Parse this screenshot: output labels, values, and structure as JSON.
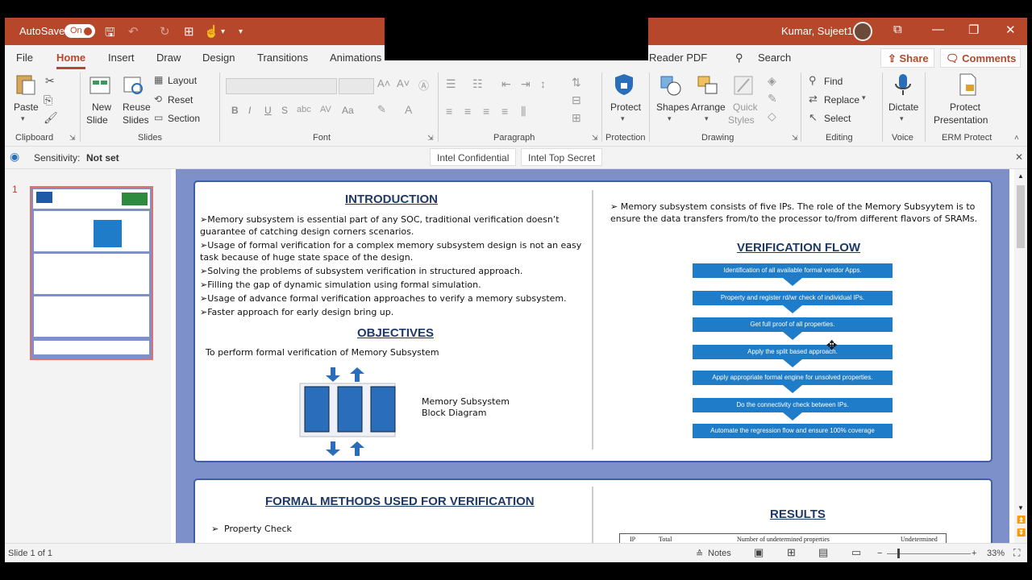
{
  "titlebar": {
    "autosave_label": "AutoSave",
    "autosave_state": "On",
    "user_name": "Kumar, Sujeet1"
  },
  "tabs": [
    "File",
    "Home",
    "Insert",
    "Draw",
    "Design",
    "Transitions",
    "Animations",
    "Reader PDF"
  ],
  "search_label": "Search",
  "share_label": "Share",
  "comments_label": "Comments",
  "ribbon": {
    "clipboard": {
      "paste": "Paste",
      "group": "Clipboard"
    },
    "slides": {
      "new_slide": "New",
      "new_slide2": "Slide",
      "reuse": "Reuse",
      "reuse2": "Slides",
      "layout": "Layout",
      "reset": "Reset",
      "section": "Section",
      "group": "Slides"
    },
    "font": {
      "group": "Font",
      "bold": "B",
      "italic": "I",
      "underline": "U",
      "strike": "S",
      "case": "Aa"
    },
    "paragraph": {
      "group": "Paragraph"
    },
    "protection": {
      "protect": "Protect",
      "group": "Protection"
    },
    "drawing": {
      "shapes": "Shapes",
      "arrange": "Arrange",
      "quick": "Quick",
      "styles": "Styles",
      "group": "Drawing"
    },
    "editing": {
      "find": "Find",
      "replace": "Replace",
      "select": "Select",
      "group": "Editing"
    },
    "voice": {
      "dictate": "Dictate",
      "group": "Voice"
    },
    "erm": {
      "protect": "Protect",
      "presentation": "Presentation",
      "group": "ERM Protect"
    }
  },
  "sensitivity": {
    "label": "Sensitivity:",
    "value": "Not set",
    "options": [
      "Intel Confidential",
      "Intel Top Secret"
    ]
  },
  "slide_number": "1",
  "slide": {
    "introduction": {
      "title": "INTRODUCTION",
      "lines": [
        "➢Memory subsystem is essential part of any SOC, traditional verification doesn’t",
        "guarantee of catching design corners scenarios.",
        "➢Usage of formal verification for a complex memory subsystem design is not an easy",
        "task because of huge state space of the design.",
        "➢Solving the problems of subsystem verification in structured approach.",
        "➢Filling the gap of dynamic simulation using formal simulation.",
        "➢Usage of advance formal verification approaches to verify a memory subsystem.",
        "➢Faster approach for early design bring up."
      ]
    },
    "objectives": {
      "title": "OBJECTIVES",
      "text": "To perform formal verification of Memory Subsystem",
      "diagram_caption_1": "Memory Subsystem",
      "diagram_caption_2": "Block Diagram"
    },
    "right_intro": [
      "➢ Memory subsystem consists of five IPs. The role of the Memory Subsyytem is to",
      "ensure the data transfers from/to the processor to/from different flavors of SRAMs."
    ],
    "verification_flow": {
      "title": "VERIFICATION FLOW",
      "steps": [
        "Identification of all available formal vendor Apps.",
        "Property and register rd/wr check of individual IPs.",
        "Get full proof of all properties.",
        "Apply the split based approach.",
        "Apply appropriate formal engine  for unsolved properties.",
        "Do the connectivity check between IPs.",
        "Automate the regression flow and ensure 100% coverage"
      ]
    },
    "formal_methods": {
      "title": "FORMAL METHODS USED FOR VERIFICATION",
      "items": [
        "Property Check"
      ]
    },
    "results": {
      "title": "RESULTS",
      "headers": [
        "IP",
        "Total",
        "Number of undetermined properties",
        "Undetermined"
      ]
    }
  },
  "status": {
    "slide_info": "Slide 1 of 1",
    "notes": "Notes",
    "zoom": "33%"
  }
}
